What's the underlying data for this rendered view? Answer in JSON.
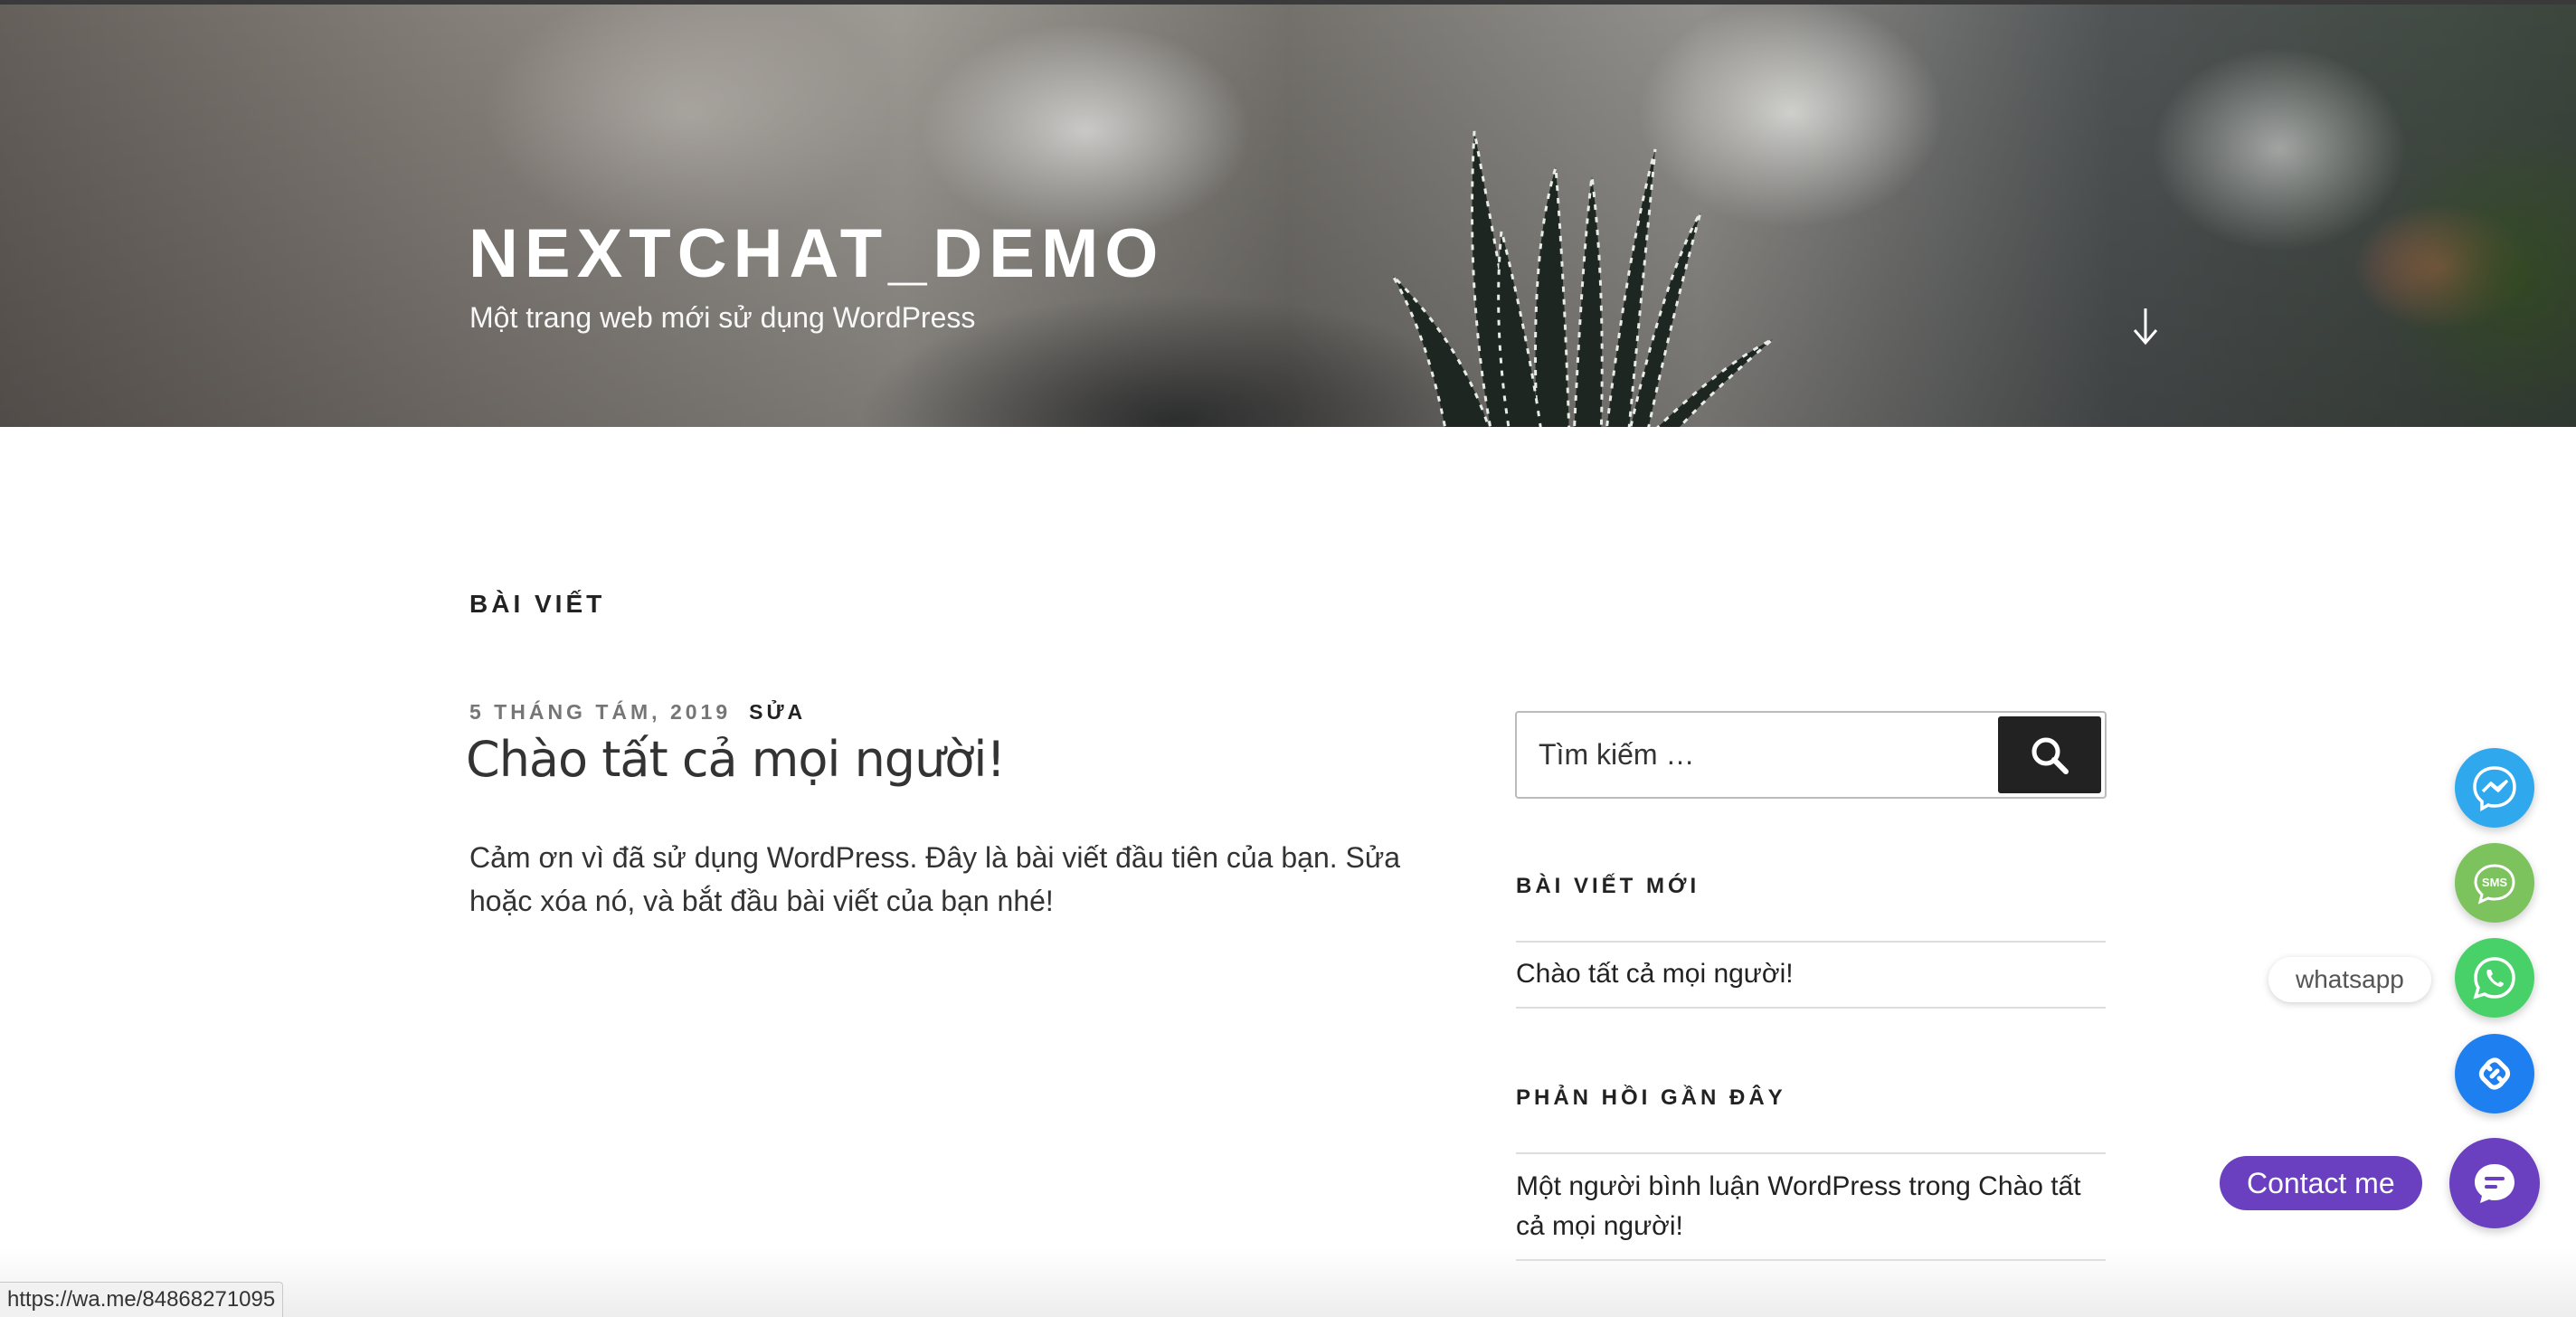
{
  "header": {
    "site_title": "NEXTCHAT_DEMO",
    "site_description": "Một trang web mới sử dụng WordPress",
    "scroll_icon": "arrow-down-icon"
  },
  "main": {
    "page_heading": "BÀI VIẾT",
    "post": {
      "date": "5 THÁNG TÁM, 2019",
      "edit_label": "SỬA",
      "title": "Chào tất cả mọi người!",
      "excerpt": "Cảm ơn vì đã sử dụng WordPress. Đây là bài viết đầu tiên của bạn. Sửa hoặc xóa nó, và bắt đầu bài viết của bạn nhé!"
    }
  },
  "sidebar": {
    "search": {
      "placeholder": "Tìm kiếm …",
      "icon": "search-icon"
    },
    "recent_posts": {
      "title": "BÀI VIẾT MỚI",
      "items": [
        "Chào tất cả mọi người!"
      ]
    },
    "recent_comments": {
      "title": "PHẢN HỒI GẦN ĐÂY",
      "items": [
        {
          "author": "Một người bình luận WordPress",
          "connector": "trong",
          "post": "Chào tất cả mọi người!"
        }
      ]
    }
  },
  "contact_widget": {
    "buttons": [
      {
        "name": "messenger",
        "icon": "messenger-icon",
        "color": "#2fa8ee"
      },
      {
        "name": "sms",
        "icon": "sms-icon",
        "label": "SMS",
        "color": "#7cc35d"
      },
      {
        "name": "whatsapp",
        "icon": "whatsapp-icon",
        "tooltip": "whatsapp",
        "color": "#49d169"
      },
      {
        "name": "link",
        "icon": "link-icon",
        "color": "#1e80f0"
      }
    ],
    "main_button": {
      "label": "Contact me",
      "icon": "chat-bubble-icon",
      "color": "#6a3fc0"
    }
  },
  "status_bar": {
    "url": "https://wa.me/84868271095"
  }
}
